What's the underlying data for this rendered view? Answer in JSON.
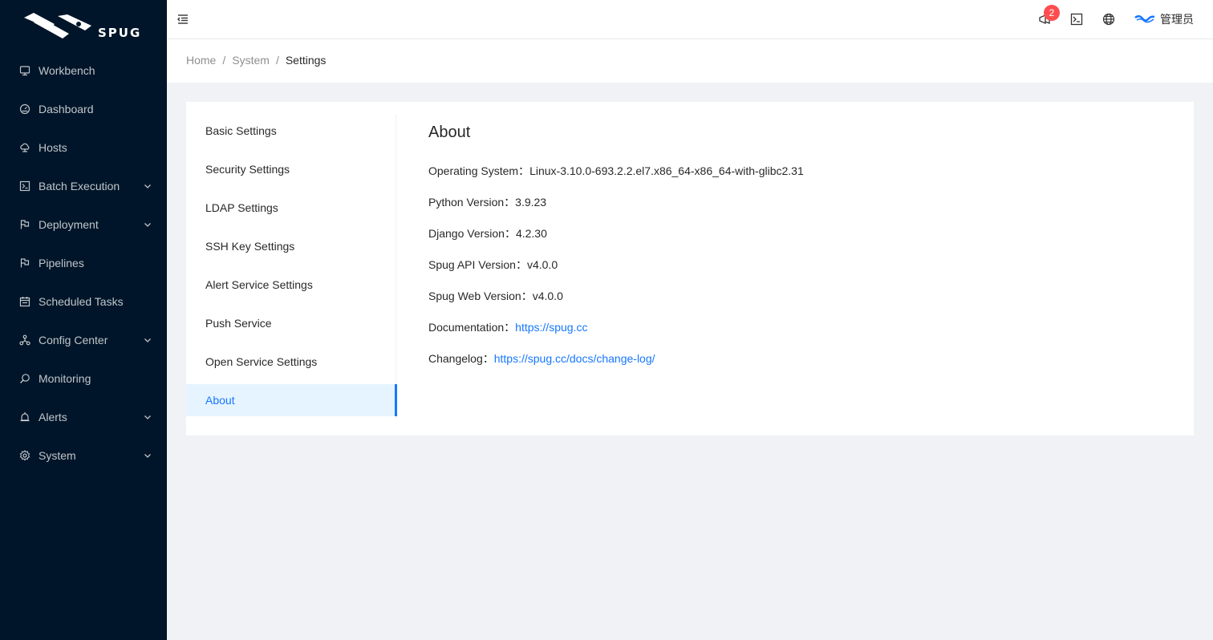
{
  "app": {
    "logo_text": "SPUG"
  },
  "sidebar": {
    "items": [
      {
        "label": "Workbench",
        "icon": "desktop-icon",
        "has_submenu": false
      },
      {
        "label": "Dashboard",
        "icon": "dashboard-icon",
        "has_submenu": false
      },
      {
        "label": "Hosts",
        "icon": "cloud-server-icon",
        "has_submenu": false
      },
      {
        "label": "Batch Execution",
        "icon": "code-icon",
        "has_submenu": true
      },
      {
        "label": "Deployment",
        "icon": "flag-icon",
        "has_submenu": true
      },
      {
        "label": "Pipelines",
        "icon": "flag-icon",
        "has_submenu": false
      },
      {
        "label": "Scheduled Tasks",
        "icon": "schedule-icon",
        "has_submenu": false
      },
      {
        "label": "Config Center",
        "icon": "deployment-unit-icon",
        "has_submenu": true
      },
      {
        "label": "Monitoring",
        "icon": "monitor-search-icon",
        "has_submenu": false
      },
      {
        "label": "Alerts",
        "icon": "alarm-icon",
        "has_submenu": true
      },
      {
        "label": "System",
        "icon": "setting-icon",
        "has_submenu": true
      }
    ]
  },
  "header": {
    "notification_count": "2",
    "user_name": "管理员"
  },
  "breadcrumb": {
    "items": [
      "Home",
      "System",
      "Settings"
    ]
  },
  "settings": {
    "tabs": [
      "Basic Settings",
      "Security Settings",
      "LDAP Settings",
      "SSH Key Settings",
      "Alert Service Settings",
      "Push Service",
      "Open Service Settings",
      "About"
    ],
    "active_tab": "About"
  },
  "about": {
    "title": "About",
    "rows": [
      {
        "label": "Operating System：",
        "value": "Linux-3.10.0-693.2.2.el7.x86_64-x86_64-with-glibc2.31",
        "link": false
      },
      {
        "label": "Python Version：",
        "value": "3.9.23",
        "link": false
      },
      {
        "label": "Django Version：",
        "value": "4.2.30",
        "link": false
      },
      {
        "label": "Spug API Version：",
        "value": "v4.0.0",
        "link": false
      },
      {
        "label": "Spug Web Version：",
        "value": "v4.0.0",
        "link": false
      },
      {
        "label": "Documentation：",
        "value": "https://spug.cc",
        "link": true
      },
      {
        "label": "Changelog：",
        "value": "https://spug.cc/docs/change-log/",
        "link": true
      }
    ]
  },
  "colors": {
    "sidebar_bg": "#001529",
    "accent": "#1677ff",
    "badge": "#ff4d4f"
  }
}
